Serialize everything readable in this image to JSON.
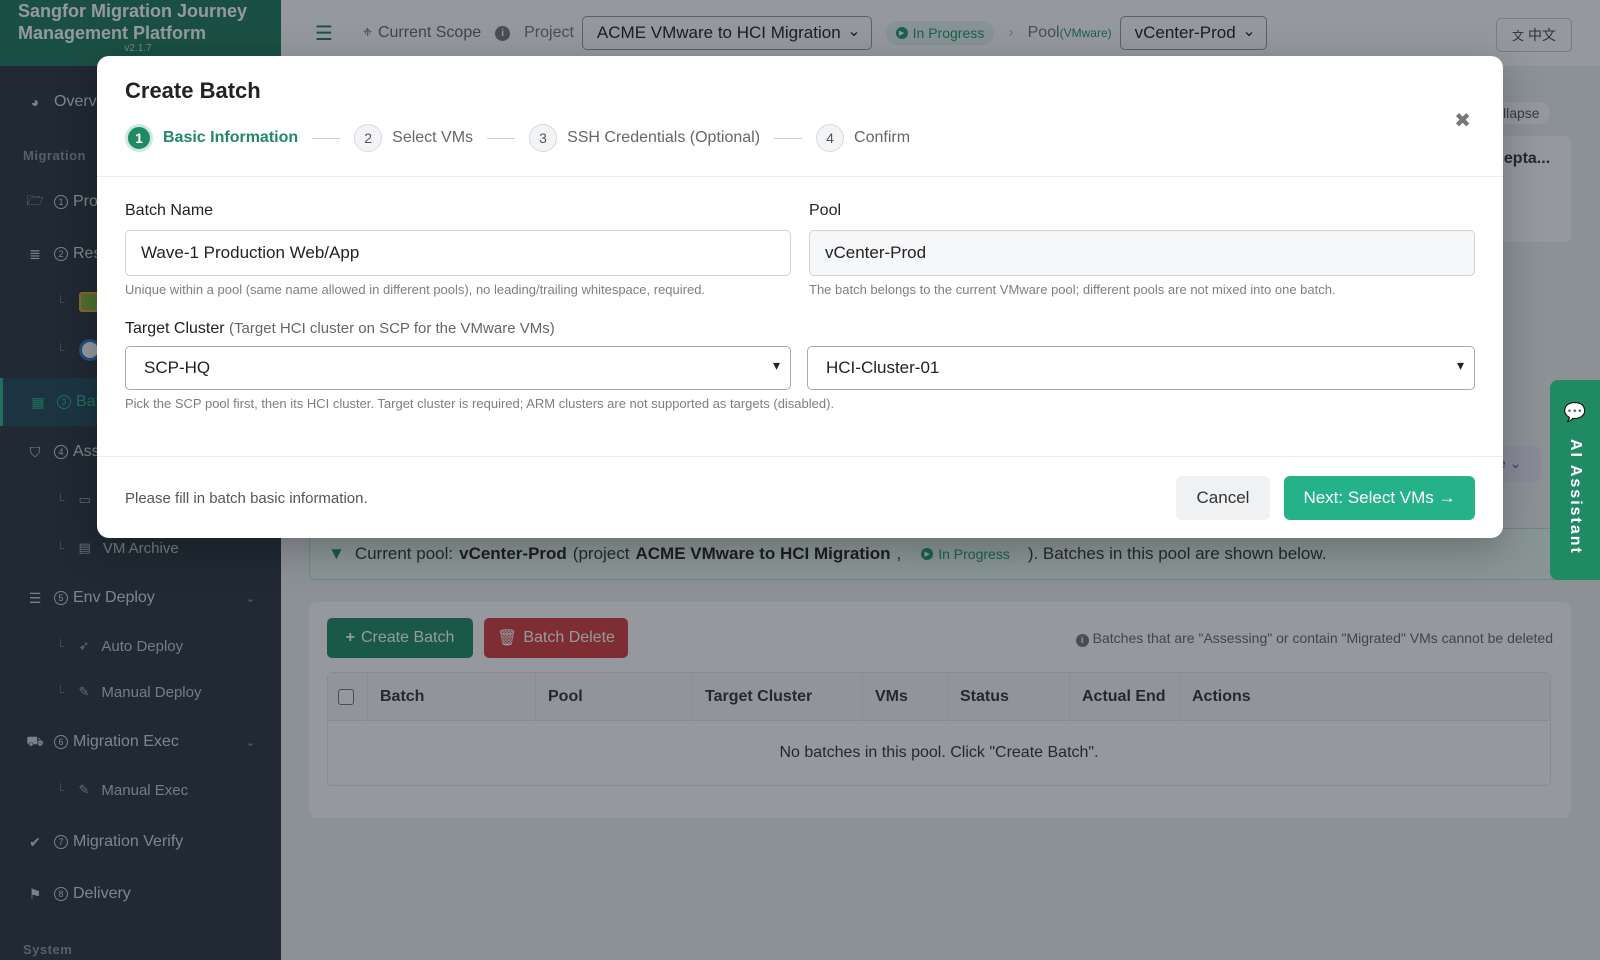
{
  "app": {
    "title_line1": "Sangfor Migration Journey",
    "title_line2": "Management Platform",
    "version": "v2.1.7"
  },
  "topbar": {
    "scope_label": "Current Scope",
    "project_label": "Project",
    "project_value": "ACME VMware to HCI Migration",
    "status": "In Progress",
    "pool_label": "Pool",
    "pool_type": "(VMware)",
    "pool_value": "vCenter-Prod",
    "lang": "中文"
  },
  "sidebar": {
    "overview": "Overv",
    "section_migration": "Migration",
    "projects": "Pro",
    "resources": "Res",
    "batches": "Bat",
    "assess": "Ass",
    "vm_archive": "VM Archive",
    "env_deploy": "Env Deploy",
    "auto_deploy": "Auto Deploy",
    "manual_deploy": "Manual Deploy",
    "migration_exec": "Migration Exec",
    "manual_exec": "Manual Exec",
    "migration_verify": "Migration Verify",
    "delivery": "Delivery",
    "section_system": "System"
  },
  "main": {
    "notice_prefix": "Current pool:",
    "notice_pool": "vCenter-Prod",
    "notice_project_prefix": "(project",
    "notice_project": "ACME VMware to HCI Migration",
    "notice_comma": ",",
    "notice_status": "In Progress",
    "notice_suffix": "). Batches in this pool are shown below.",
    "create_batch": "Create Batch",
    "batch_delete": "Batch Delete",
    "delete_note": "Batches that are \"Assessing\" or contain \"Migrated\" VMs cannot be deleted",
    "columns": [
      "Batch",
      "Pool",
      "Target Cluster",
      "VMs",
      "Status",
      "Actual End",
      "Actions"
    ],
    "empty": "No batches in this pool. Click \"Create Batch\".",
    "peek_collapse": "llapse",
    "peek_accept": "cepta...",
    "peek_e": "e",
    "peek_se": "se"
  },
  "ai_assistant": "AI Assistant",
  "modal": {
    "title": "Create Batch",
    "steps": [
      {
        "num": "1",
        "label": "Basic Information"
      },
      {
        "num": "2",
        "label": "Select VMs"
      },
      {
        "num": "3",
        "label": "SSH Credentials (Optional)"
      },
      {
        "num": "4",
        "label": "Confirm"
      }
    ],
    "batch_name_label": "Batch Name",
    "batch_name_value": "Wave-1 Production Web/App",
    "batch_name_hint": "Unique within a pool (same name allowed in different pools), no leading/trailing whitespace, required.",
    "pool_label": "Pool",
    "pool_value": "vCenter-Prod",
    "pool_hint": "The batch belongs to the current VMware pool; different pools are not mixed into one batch.",
    "target_label": "Target Cluster",
    "target_sub": "(Target HCI cluster on SCP for the VMware VMs)",
    "scp_value": "SCP-HQ",
    "cluster_value": "HCI-Cluster-01",
    "target_hint": "Pick the SCP pool first, then its HCI cluster. Target cluster is required; ARM clusters are not supported as targets (disabled).",
    "footer_msg": "Please fill in batch basic information.",
    "cancel": "Cancel",
    "next": "Next: Select VMs →"
  }
}
